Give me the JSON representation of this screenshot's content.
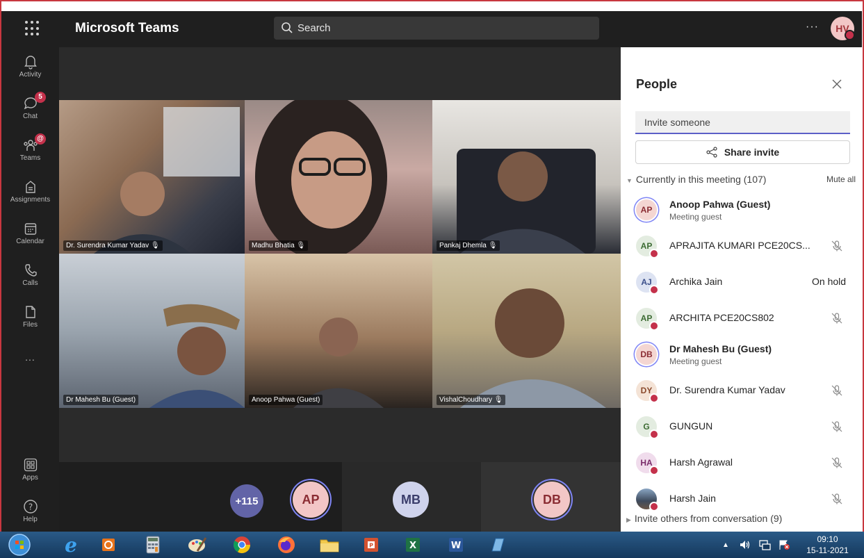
{
  "app": {
    "title": "Microsoft Teams",
    "search_placeholder": "Search",
    "more": "···",
    "user_initials": "HV"
  },
  "rail": [
    {
      "label": "Activity",
      "icon": "bell-icon"
    },
    {
      "label": "Chat",
      "icon": "chat-icon",
      "badge": "5"
    },
    {
      "label": "Teams",
      "icon": "teams-icon",
      "badge": "@"
    },
    {
      "label": "Assignments",
      "icon": "assignments-icon"
    },
    {
      "label": "Calendar",
      "icon": "calendar-icon"
    },
    {
      "label": "Calls",
      "icon": "phone-icon"
    },
    {
      "label": "Files",
      "icon": "file-icon"
    },
    {
      "label": "...",
      "icon": "more-icon"
    },
    {
      "label": "Apps",
      "icon": "apps-icon"
    },
    {
      "label": "Help",
      "icon": "help-icon"
    }
  ],
  "videos": [
    {
      "name": "Dr. Surendra Kumar Yadav",
      "muted": true
    },
    {
      "name": "Madhu Bhatia",
      "muted": true
    },
    {
      "name": "Pankaj Dhemla",
      "muted": true
    },
    {
      "name": "Dr Mahesh Bu (Guest)",
      "muted": false
    },
    {
      "name": "Anoop Pahwa (Guest)",
      "muted": false
    },
    {
      "name": "VishalChoudhary",
      "muted": true
    }
  ],
  "strip": {
    "overflow": "+115",
    "bubbles": [
      "AP",
      "MB",
      "DB"
    ]
  },
  "people": {
    "title": "People",
    "invite_placeholder": "Invite someone",
    "share_label": "Share invite",
    "section_label": "Currently in this meeting (107)",
    "mute_all": "Mute all",
    "participants": [
      {
        "initials": "AP",
        "name": "Anoop Pahwa (Guest)",
        "sub": "Meeting guest",
        "bold": true,
        "status": ""
      },
      {
        "initials": "AP",
        "name": "APRAJITA KUMARI PCE20CS...",
        "sub": "",
        "bold": false,
        "status": "muted"
      },
      {
        "initials": "AJ",
        "name": "Archika Jain",
        "sub": "",
        "bold": false,
        "status": "On hold"
      },
      {
        "initials": "AP",
        "name": "ARCHITA PCE20CS802",
        "sub": "",
        "bold": false,
        "status": "muted"
      },
      {
        "initials": "DB",
        "name": "Dr Mahesh Bu (Guest)",
        "sub": "Meeting guest",
        "bold": true,
        "status": ""
      },
      {
        "initials": "DY",
        "name": "Dr. Surendra Kumar Yadav",
        "sub": "",
        "bold": false,
        "status": "muted"
      },
      {
        "initials": "G",
        "name": "GUNGUN",
        "sub": "",
        "bold": false,
        "status": "muted"
      },
      {
        "initials": "HA",
        "name": "Harsh Agrawal",
        "sub": "",
        "bold": false,
        "status": "muted"
      },
      {
        "initials": "",
        "name": "Harsh Jain",
        "sub": "",
        "bold": false,
        "status": "muted"
      }
    ],
    "footer": "Invite others from conversation (9)"
  },
  "taskbar": {
    "time": "09:10",
    "date": "15-11-2021"
  },
  "colors": {
    "accent": "#5b5fc7",
    "presence_busy": "#c4314b",
    "dark_bg": "#1f1f1f"
  }
}
